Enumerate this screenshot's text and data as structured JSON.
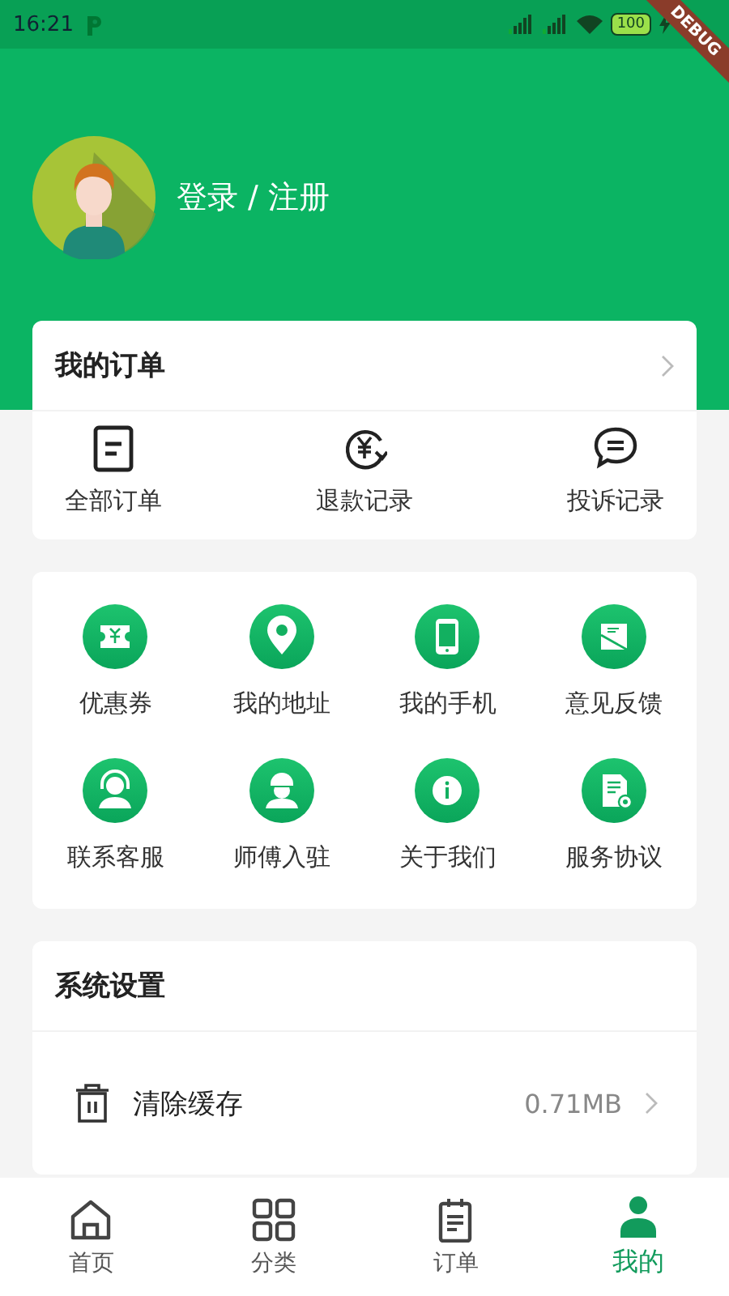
{
  "status_bar": {
    "time": "16:21",
    "battery": "100"
  },
  "debug_banner": "DEBUG",
  "profile": {
    "login_label": "登录 / 注册"
  },
  "orders": {
    "title": "我的订单",
    "items": [
      {
        "label": "全部订单"
      },
      {
        "label": "退款记录"
      },
      {
        "label": "投诉记录"
      }
    ]
  },
  "services": {
    "items": [
      {
        "label": "优惠券"
      },
      {
        "label": "我的地址"
      },
      {
        "label": "我的手机"
      },
      {
        "label": "意见反馈"
      },
      {
        "label": "联系客服"
      },
      {
        "label": "师傅入驻"
      },
      {
        "label": "关于我们"
      },
      {
        "label": "服务协议"
      }
    ]
  },
  "settings": {
    "title": "系统设置",
    "items": [
      {
        "label": "清除缓存",
        "value": "0.71MB"
      }
    ]
  },
  "tab_bar": [
    {
      "label": "首页",
      "selected": false
    },
    {
      "label": "分类",
      "selected": false
    },
    {
      "label": "订单",
      "selected": false
    },
    {
      "label": "我的",
      "selected": true
    }
  ]
}
